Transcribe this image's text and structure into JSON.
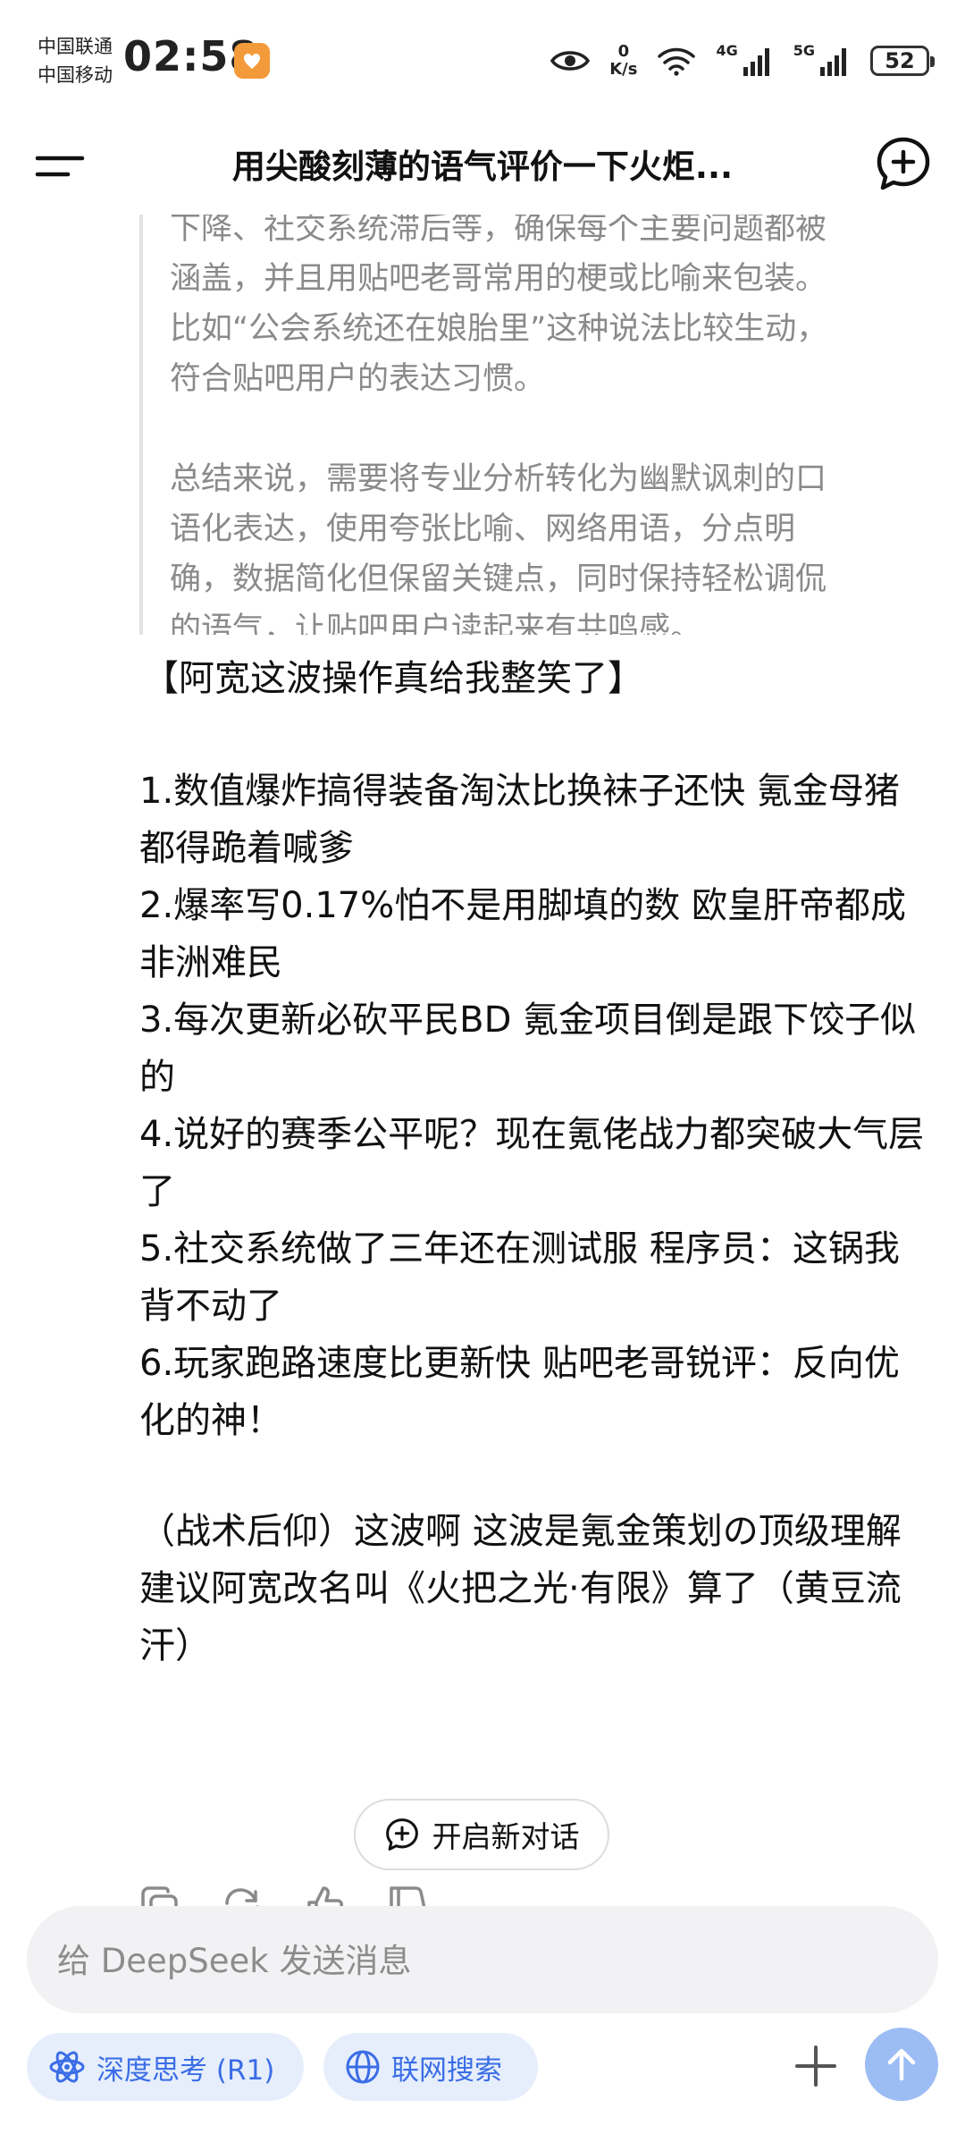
{
  "status": {
    "carrier1": "中国联通",
    "carrier2": "中国移动",
    "time": "02:58",
    "speed_value": "0",
    "speed_unit": "K/s",
    "net1": "4G",
    "net2": "5G",
    "battery": "52"
  },
  "header": {
    "title": "用尖酸刻薄的语气评价一下火炬..."
  },
  "thinking": {
    "paragraph1": [
      "下降、社交系统滞后等，确保每个主要问题都被",
      "涵盖，并且用贴吧老哥常用的梗或比喻来包装。",
      "比如“公会系统还在娘胎里”这种说法比较生动，",
      "符合贴吧用户的表达习惯。"
    ],
    "paragraph2": [
      "总结来说，需要将专业分析转化为幽默讽刺的口",
      "语化表达，使用夸张比喻、网络用语，分点明",
      "确，数据简化但保留关键点，同时保持轻松调侃",
      "的语气，让贴吧用户读起来有共鸣感。"
    ]
  },
  "answer": {
    "headline": "【阿宽这波操作真给我整笑了】",
    "items": [
      "1.数值爆炸搞得装备淘汰比换袜子还快 氪金母猪都得跪着喊爹",
      "2.爆率写0.17%怕不是用脚填的数 欧皇肝帝都成非洲难民",
      "3.每次更新必砍平民BD 氪金项目倒是跟下饺子似的",
      "4.说好的赛季公平呢？现在氪佬战力都突破大气层了",
      "5.社交系统做了三年还在测试服 程序员：这锅我背不动了",
      "6.玩家跑路速度比更新快 贴吧老哥锐评：反向优化的神！"
    ],
    "closing": "（战术后仰）这波啊 这波是氪金策划の顶级理解 建议阿宽改名叫《火把之光·有限》算了（黄豆流汗）"
  },
  "new_dialog_label": "开启新对话",
  "composer": {
    "placeholder": "给 DeepSeek 发送消息"
  },
  "toolbar": {
    "deep_think_label": "深度思考 (R1)",
    "web_search_label": "联网搜索"
  },
  "colors": {
    "accent": "#3a6de6",
    "chip_bg": "#e6eefc",
    "send_bg": "#9cbcf4",
    "thinking_text": "#8a8a8a"
  },
  "icons": [
    "menu-icon",
    "new-chat-icon",
    "eye-icon",
    "wifi-icon",
    "copy-icon",
    "regenerate-icon",
    "thumbs-up-icon",
    "thumbs-down-icon",
    "atom-icon",
    "globe-icon",
    "plus-icon",
    "arrow-up-icon"
  ]
}
